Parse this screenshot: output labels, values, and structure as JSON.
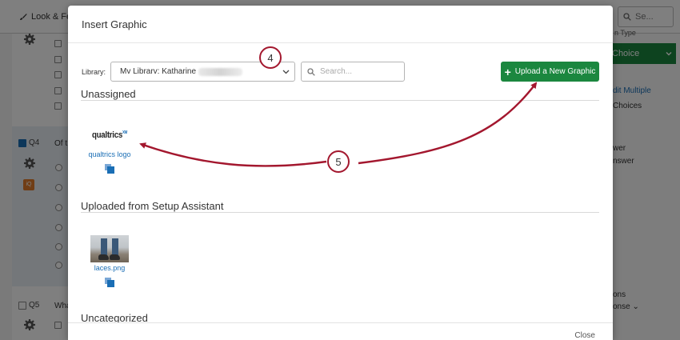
{
  "background": {
    "look_and_feel_label": "Look & Fee",
    "search_placeholder": "Se...",
    "question_type_label": "n Type",
    "choice_button_label": "Choice",
    "right_panel": {
      "edit_multiple": "dit Multiple",
      "choices": "Choices",
      "answer_1": "wer",
      "answer_2": "nswer",
      "options": "ons",
      "response": "onse"
    },
    "q4_label": "Q4",
    "q4_text": "Of t",
    "q5_label": "Q5",
    "q5_text": "Wha",
    "iq_badge": "iQ"
  },
  "modal": {
    "title": "Insert Graphic",
    "library_label": "Library:",
    "library_value": "Mv Librarv: Katharine",
    "search_placeholder": "Search...",
    "upload_button_label": "Upload a New Graphic",
    "sections": [
      {
        "title": "Unassigned",
        "items": [
          {
            "name": "qualtrics logo",
            "thumb_text": "qualtrics",
            "thumb_mark": "XM"
          }
        ]
      },
      {
        "title": "Uploaded from Setup Assistant",
        "items": [
          {
            "name": "laces.png"
          }
        ]
      },
      {
        "title": "Uncategorized",
        "items": []
      }
    ],
    "close_label": "Close"
  },
  "annotations": [
    {
      "label": "4"
    },
    {
      "label": "5"
    }
  ],
  "colors": {
    "accent_green": "#1b873f",
    "link_blue": "#1a6eb5",
    "annotation_red": "#a3172e"
  }
}
